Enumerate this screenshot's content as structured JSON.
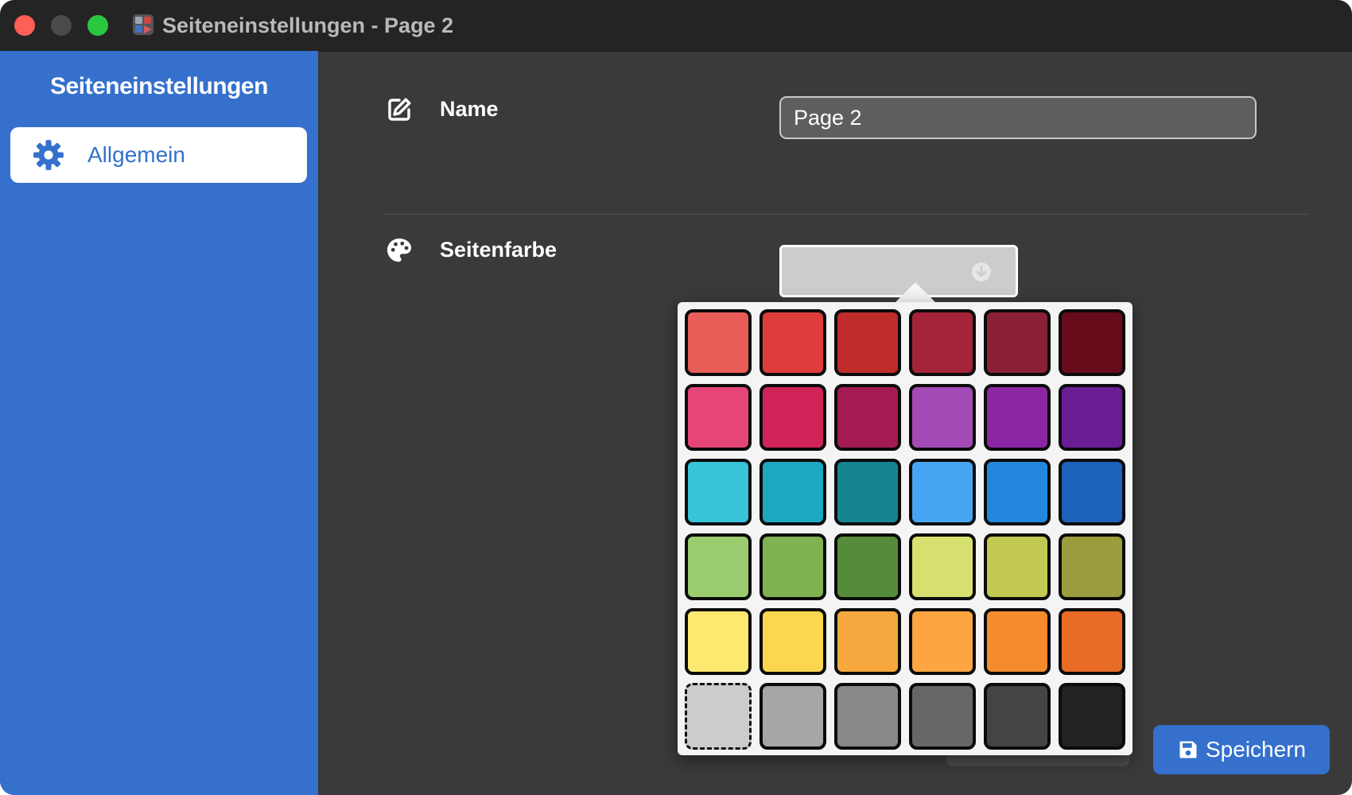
{
  "window": {
    "title": "Seiteneinstellungen - Page 2",
    "app_icon": "palette-grid-app-icon"
  },
  "sidebar": {
    "title": "Seiteneinstellungen",
    "items": [
      {
        "label": "Allgemein",
        "icon": "gear-icon",
        "selected": true
      }
    ]
  },
  "form": {
    "name": {
      "label": "Name",
      "icon": "edit-icon",
      "value": "Page 2"
    },
    "page_color": {
      "label": "Seitenfarbe",
      "icon": "palette-icon",
      "selected_color": "#cccccc",
      "dropdown_icon": "arrow-down-circle-icon"
    }
  },
  "palette": {
    "colors": [
      "#e95d58",
      "#de3c3a",
      "#c02b2c",
      "#a42338",
      "#8a2035",
      "#680b1b",
      "#e64578",
      "#d02358",
      "#a31b52",
      "#a44ab6",
      "#8b26a5",
      "#6a1d95",
      "#37c3d8",
      "#1ea9c1",
      "#168592",
      "#46a5f2",
      "#2387de",
      "#1d62bb",
      "#9bcc70",
      "#7fb352",
      "#568b3b",
      "#d6e06f",
      "#c2ca52",
      "#9b9c3c",
      "#fde96f",
      "#fbd74f",
      "#f6a83e",
      "#fca541",
      "#f58b2c",
      "#e86c25",
      "#cccccc",
      "#a6a6a6",
      "#888888",
      "#666666",
      "#444444",
      "#222222"
    ],
    "selected_index": 30
  },
  "actions": {
    "save_label": "Speichern",
    "save_icon": "save-disk-icon"
  },
  "accent_color": "#3470cc"
}
